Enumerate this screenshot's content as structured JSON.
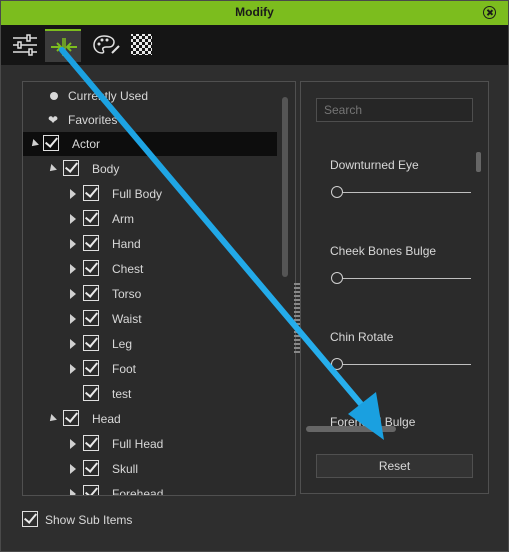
{
  "window": {
    "title": "Modify"
  },
  "toolbar": {
    "tools": [
      {
        "name": "sliders-icon"
      },
      {
        "name": "morph-icon",
        "active": true
      },
      {
        "name": "palette-icon"
      },
      {
        "name": "checker-icon"
      }
    ]
  },
  "tree": {
    "items": [
      {
        "label": "Currently Used",
        "icon": "dot"
      },
      {
        "label": "Favorites",
        "icon": "heart"
      },
      {
        "label": "Actor",
        "checked": true,
        "expanded": true,
        "selected": true
      },
      {
        "label": "Body",
        "checked": true,
        "expanded": true
      },
      {
        "label": "Full Body",
        "checked": true
      },
      {
        "label": "Arm",
        "checked": true
      },
      {
        "label": "Hand",
        "checked": true
      },
      {
        "label": "Chest",
        "checked": true
      },
      {
        "label": "Torso",
        "checked": true
      },
      {
        "label": "Waist",
        "checked": true
      },
      {
        "label": "Leg",
        "checked": true
      },
      {
        "label": "Foot",
        "checked": true
      },
      {
        "label": "test",
        "checked": true
      },
      {
        "label": "Head",
        "checked": true,
        "expanded": true
      },
      {
        "label": "Full Head",
        "checked": true
      },
      {
        "label": "Skull",
        "checked": true
      },
      {
        "label": "Forehead",
        "checked": true
      }
    ]
  },
  "right": {
    "search_placeholder": "Search",
    "sliders": [
      {
        "label": "Downturned Eye",
        "value": 0
      },
      {
        "label": "Cheek Bones Bulge",
        "value": 0
      },
      {
        "label": "Chin Rotate",
        "value": 0
      },
      {
        "label": "Forehead Bulge",
        "value": 0
      }
    ],
    "reset_label": "Reset"
  },
  "footer": {
    "show_sub_items_label": "Show Sub Items",
    "show_sub_items_checked": true
  },
  "colors": {
    "accent": "#7cbd1e",
    "annotation_arrow": "#1aa0e0"
  }
}
